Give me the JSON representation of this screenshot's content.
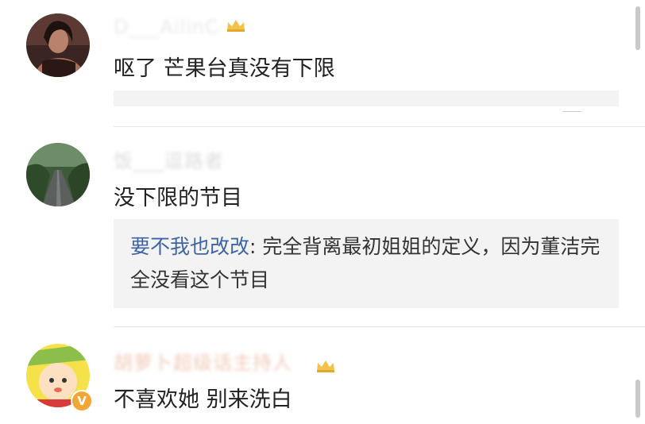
{
  "comments": [
    {
      "username": "D___AilinC",
      "text": "呕了 芒果台真没有下限",
      "avatar_icon": "user-photo-woman",
      "badge_icon": "crown-icon"
    },
    {
      "username": "饭___逗路者",
      "text": "没下限的节目",
      "avatar_icon": "user-photo-path",
      "quote": {
        "user": "要不我也改改",
        "text": ": 完全背离最初姐姐的定义，因为董洁完全没看这个节目"
      }
    },
    {
      "username": "胡萝卜超级话主持人",
      "text": "不喜欢她 别来洗白",
      "avatar_icon": "cartoon-avatar",
      "verified_label": "V",
      "badge_icon": "crown-icon"
    }
  ],
  "colors": {
    "link_blue": "#3e64a6",
    "quote_bg": "#f3f3f4",
    "verified_orange": "#f3a536",
    "crown_gold": "#f2c24a"
  }
}
